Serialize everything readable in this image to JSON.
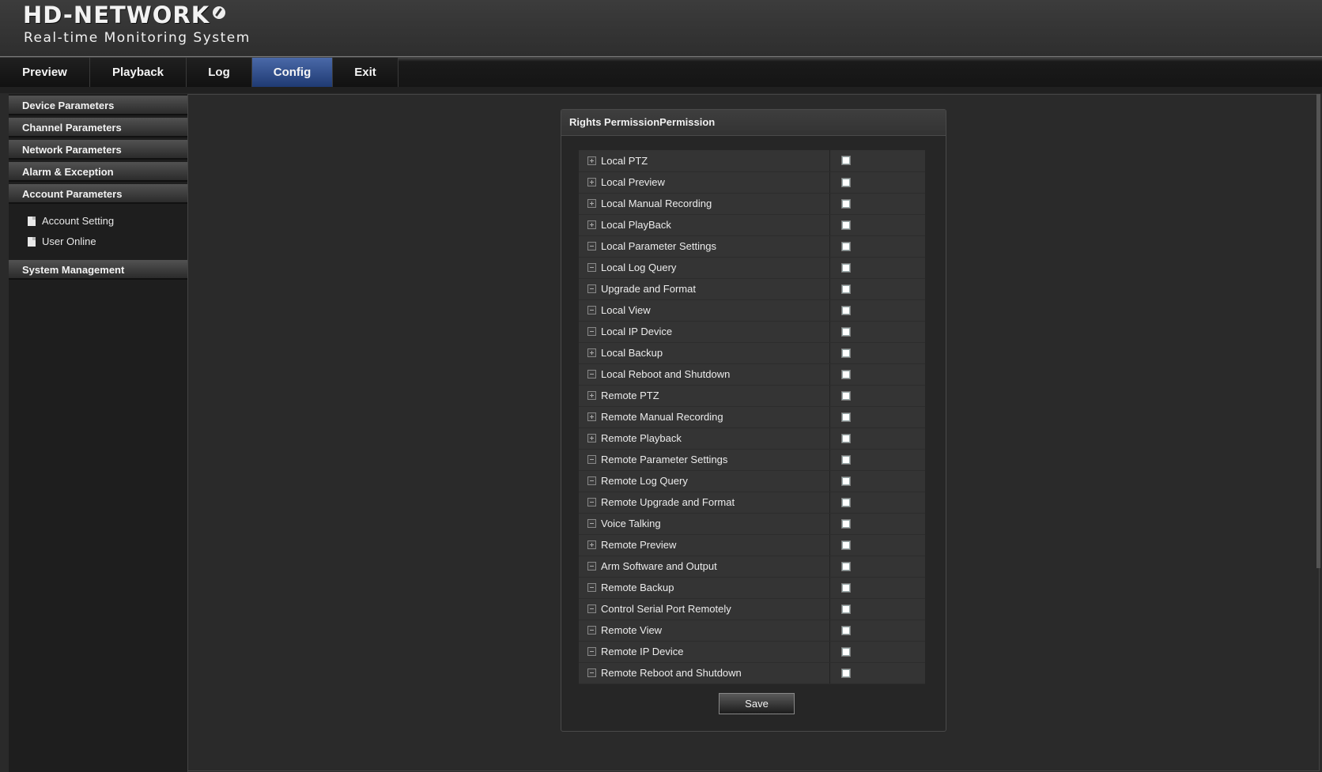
{
  "header": {
    "title": "HD-NETWORK",
    "subtitle": "Real-time Monitoring System",
    "logo_icon": "globe-icon"
  },
  "nav": {
    "tabs": [
      {
        "label": "Preview"
      },
      {
        "label": "Playback"
      },
      {
        "label": "Log"
      },
      {
        "label": "Config",
        "active": true
      },
      {
        "label": "Exit"
      }
    ],
    "active_color": "#2f4f8f"
  },
  "sidebar": {
    "sections": [
      {
        "label": "Device Parameters"
      },
      {
        "label": "Channel Parameters"
      },
      {
        "label": "Network Parameters"
      },
      {
        "label": "Alarm & Exception"
      },
      {
        "label": "Account Parameters"
      },
      {
        "label": "System Management"
      }
    ],
    "sub_items": [
      {
        "label": "Account Setting",
        "icon": "document-icon"
      },
      {
        "label": "User Online",
        "icon": "document-icon"
      }
    ]
  },
  "panel": {
    "title": "Rights PermissionPermission",
    "permissions": [
      {
        "label": "Local PTZ",
        "expander": "plus",
        "checked": false
      },
      {
        "label": "Local Preview",
        "expander": "plus",
        "checked": false
      },
      {
        "label": "Local Manual Recording",
        "expander": "plus",
        "checked": false
      },
      {
        "label": "Local PlayBack",
        "expander": "plus",
        "checked": false
      },
      {
        "label": "Local Parameter Settings",
        "expander": "minus",
        "checked": false
      },
      {
        "label": "Local Log Query",
        "expander": "minus",
        "checked": false
      },
      {
        "label": "Upgrade and Format",
        "expander": "minus",
        "checked": false
      },
      {
        "label": "Local View",
        "expander": "minus",
        "checked": false
      },
      {
        "label": "Local IP Device",
        "expander": "minus",
        "checked": false
      },
      {
        "label": "Local Backup",
        "expander": "plus",
        "checked": false
      },
      {
        "label": "Local Reboot and Shutdown",
        "expander": "minus",
        "checked": false
      },
      {
        "label": "Remote PTZ",
        "expander": "plus",
        "checked": false
      },
      {
        "label": "Remote Manual Recording",
        "expander": "plus",
        "checked": false
      },
      {
        "label": "Remote Playback",
        "expander": "plus",
        "checked": false
      },
      {
        "label": "Remote Parameter Settings",
        "expander": "minus",
        "checked": false
      },
      {
        "label": "Remote Log Query",
        "expander": "minus",
        "checked": false
      },
      {
        "label": "Remote Upgrade and Format",
        "expander": "minus",
        "checked": false
      },
      {
        "label": "Voice Talking",
        "expander": "minus",
        "checked": false
      },
      {
        "label": "Remote Preview",
        "expander": "plus",
        "checked": false
      },
      {
        "label": "Arm Software and Output",
        "expander": "minus",
        "checked": false
      },
      {
        "label": "Remote Backup",
        "expander": "minus",
        "checked": false
      },
      {
        "label": "Control Serial Port Remotely",
        "expander": "minus",
        "checked": false
      },
      {
        "label": "Remote View",
        "expander": "minus",
        "checked": false
      },
      {
        "label": "Remote IP Device",
        "expander": "minus",
        "checked": false
      },
      {
        "label": "Remote Reboot and Shutdown",
        "expander": "minus",
        "checked": false
      }
    ],
    "save_label": "Save"
  }
}
